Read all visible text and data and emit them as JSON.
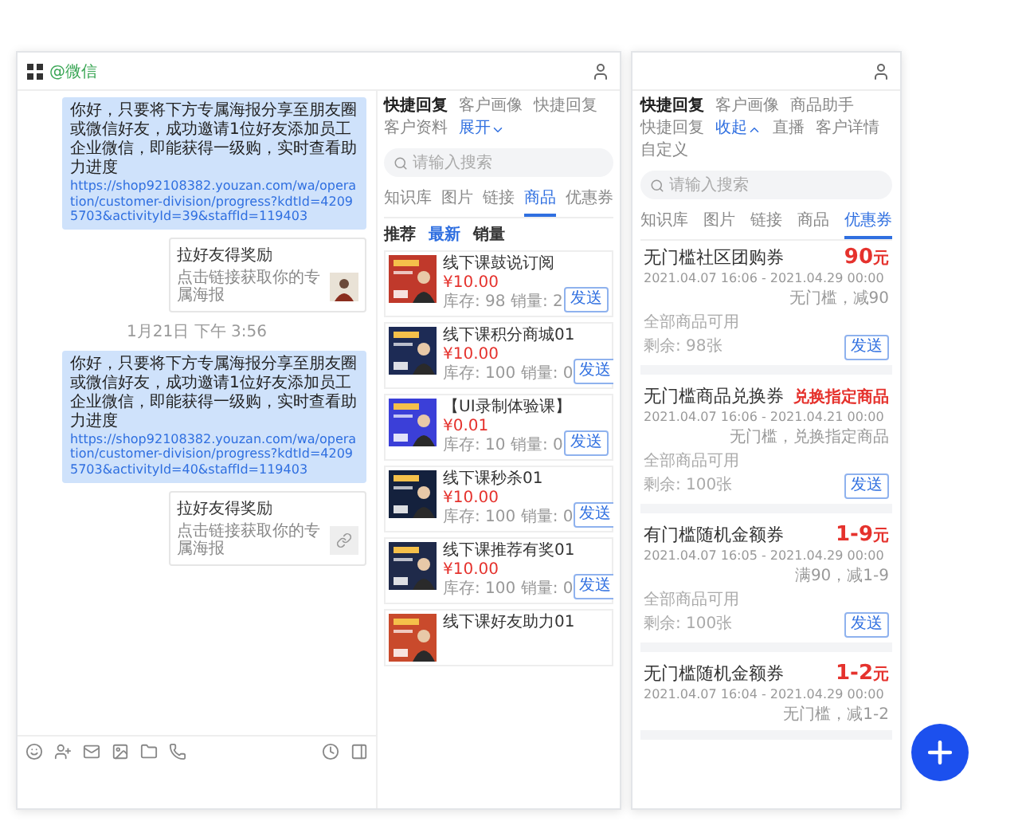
{
  "chat_window": {
    "header": {
      "app_label": "@微信"
    },
    "messages": [
      {
        "kind": "text",
        "text": "你好，只要将下方专属海报分享至朋友圈或微信好友，成功邀请1位好友添加员工企业微信，即能获得一级购，实时查看助力进度",
        "link": "https://shop92108382.youzan.com/wa/operation/customer-division/progress?kdtId=42095703&activityId=39&staffId=119403"
      },
      {
        "kind": "card",
        "title": "拉好友得奖励",
        "description": "点击链接获取你的专属海报"
      },
      {
        "kind": "time",
        "text": "1月21日 下午 3:56"
      },
      {
        "kind": "text",
        "text": "你好，只要将下方专属海报分享至朋友圈或微信好友，成功邀请1位好友添加员工企业微信，即能获得一级购，实时查看助力进度",
        "link": "https://shop92108382.youzan.com/wa/operation/customer-division/progress?kdtId=42095703&activityId=40&staffId=119403"
      },
      {
        "kind": "card",
        "title": "拉好友得奖励",
        "description": "点击链接获取你的专属海报",
        "preview": {
          "kind": "link"
        }
      }
    ],
    "sidebar": {
      "tabs": [
        {
          "kind": "tab",
          "label": "快捷回复",
          "selected": true
        },
        {
          "kind": "tab",
          "label": "客户画像",
          "selected": false
        },
        {
          "kind": "tab",
          "label": "快捷回复",
          "selected": false
        },
        {
          "kind": "tab",
          "label": "客户资料",
          "selected": false
        },
        {
          "kind": "toggle",
          "label": "展开",
          "expanded": false
        }
      ],
      "search": {
        "placeholder": "请输入搜索"
      },
      "categories": [
        {
          "label": "知识库",
          "selected": false
        },
        {
          "label": "图片",
          "selected": false
        },
        {
          "label": "链接",
          "selected": false
        },
        {
          "label": "商品",
          "selected": true
        },
        {
          "label": "优惠券",
          "selected": false
        }
      ],
      "sort": [
        {
          "label": "推荐",
          "selected": false
        },
        {
          "label": "最新",
          "selected": true
        },
        {
          "label": "销量",
          "selected": false
        }
      ],
      "products": [
        {
          "title": "线下课鼓说订阅",
          "price": "¥10.00",
          "stock": "库存: 98  销量: 2",
          "button": "发送"
        },
        {
          "title": "线下课积分商城01",
          "price": "¥10.00",
          "stock": "库存: 100  销量: 0",
          "button": "发送"
        },
        {
          "title": "【UI录制体验课】",
          "price": "¥0.01",
          "stock": "库存: 10  销量: 0",
          "button": "发送"
        },
        {
          "title": "线下课秒杀01",
          "price": "¥10.00",
          "stock": "库存: 100  销量: 0",
          "button": "发送"
        },
        {
          "title": "线下课推荐有奖01",
          "price": "¥10.00",
          "stock": "库存: 100  销量: 0",
          "button": "发送"
        },
        {
          "title": "线下课好友助力01"
        }
      ]
    }
  },
  "assistant_panel": {
    "tabs": [
      {
        "kind": "tab",
        "label": "快捷回复",
        "selected": true
      },
      {
        "kind": "tab",
        "label": "客户画像",
        "selected": false
      },
      {
        "kind": "tab",
        "label": "商品助手",
        "selected": false
      },
      {
        "kind": "tab",
        "label": "快捷回复",
        "selected": false
      },
      {
        "kind": "toggle",
        "label": "收起",
        "expanded": true
      },
      {
        "kind": "tab",
        "label": "直播",
        "selected": false
      },
      {
        "kind": "tab",
        "label": "客户详情",
        "selected": false
      },
      {
        "kind": "tab",
        "label": "自定义",
        "selected": false
      }
    ],
    "search": {
      "placeholder": "请输入搜索"
    },
    "categories": [
      {
        "label": "知识库",
        "selected": false
      },
      {
        "label": "图片",
        "selected": false
      },
      {
        "label": "链接",
        "selected": false
      },
      {
        "label": "商品",
        "selected": false
      },
      {
        "label": "优惠券",
        "selected": true
      }
    ],
    "coupons": [
      {
        "title": "无门槛社区团购券",
        "amount": "90",
        "unit": "元",
        "period": "2021.04.07 16:06 - 2021.04.29 00:00",
        "condition": "无门槛，减90",
        "scope": "全部商品可用",
        "remaining": "剩余: 98张",
        "button": "发送"
      },
      {
        "title": "无门槛商品兑换券",
        "amount": "兑换指定商品",
        "period": "2021.04.07 16:06 - 2021.04.21 00:00",
        "condition": "无门槛，兑换指定商品",
        "scope": "全部商品可用",
        "remaining": "剩余: 100张",
        "button": "发送"
      },
      {
        "title": "有门槛随机金额券",
        "amount": "1-9",
        "unit": "元",
        "period": "2021.04.07 16:05 - 2021.04.29 00:00",
        "condition": "满90，减1-9",
        "scope": "全部商品可用",
        "remaining": "剩余: 100张",
        "button": "发送"
      },
      {
        "title": "无门槛随机金额券",
        "amount": "1-2",
        "unit": "元",
        "period": "2021.04.07 16:04 - 2021.04.29 00:00",
        "condition": "无门槛，减1-2"
      }
    ]
  }
}
